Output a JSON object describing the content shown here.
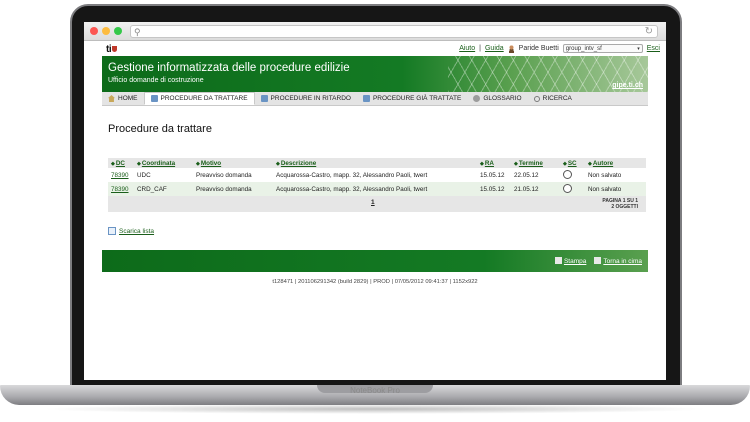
{
  "device": {
    "brand": "NoteBook Pro"
  },
  "browser": {
    "reload_icon": "reload-icon",
    "search_icon": "search-icon"
  },
  "topbar": {
    "logo": "ti",
    "links": {
      "help": "Aiuto",
      "guide": "Guida",
      "exit": "Esci"
    },
    "user_name": "Paride Buetti",
    "group_select": "group_intv_sf"
  },
  "header": {
    "title": "Gestione informatizzata delle procedure edilizie",
    "subtitle": "Ufficio domande di costruzione",
    "site": "gipe.ti.ch"
  },
  "tabs": [
    {
      "label": "HOME",
      "icon": "home-icon",
      "active": false
    },
    {
      "label": "PROCEDURE DA TRATTARE",
      "icon": "document-icon",
      "active": true
    },
    {
      "label": "PROCEDURE IN RITARDO",
      "icon": "document-icon",
      "active": false
    },
    {
      "label": "PROCEDURE GIÀ TRATTATE",
      "icon": "document-icon",
      "active": false
    },
    {
      "label": "GLOSSARIO",
      "icon": "glossary-icon",
      "active": false
    },
    {
      "label": "RICERCA",
      "icon": "search-icon",
      "active": false
    }
  ],
  "main": {
    "page_title": "Procedure da trattare",
    "table": {
      "columns": [
        "DC",
        "Coordinata",
        "Motivo",
        "Descrizione",
        "RA",
        "Termine",
        "SC",
        "Autore"
      ],
      "rows": [
        {
          "dc": "78390",
          "coordinata": "UDC",
          "motivo": "Preavviso domanda",
          "descrizione": "Acquarossa-Castro, mapp. 32, Alessandro Paoli, twert",
          "ra": "15.05.12",
          "termine": "22.05.12",
          "autore": "Non salvato"
        },
        {
          "dc": "78390",
          "coordinata": "CRD_CAF",
          "motivo": "Preavviso domanda",
          "descrizione": "Acquarossa-Castro, mapp. 32, Alessandro Paoli, twert",
          "ra": "15.05.12",
          "termine": "21.05.12",
          "autore": "Non salvato"
        }
      ],
      "pager": {
        "page": "1",
        "page_info": "PAGINA 1 SU 1",
        "count_info": "2 OGGETTI"
      }
    },
    "download_label": "Scarica lista"
  },
  "footer": {
    "print_label": "Stampa",
    "top_label": "Torna in cima",
    "build_info": "t128471 | 201106291342 (build 2829) | PROD | 07/05/2012 09:41:37 | 1152x922"
  },
  "colors": {
    "brand_green": "#147a24",
    "link_green": "#1a5e1a",
    "row_alt": "#e9f2e7"
  }
}
